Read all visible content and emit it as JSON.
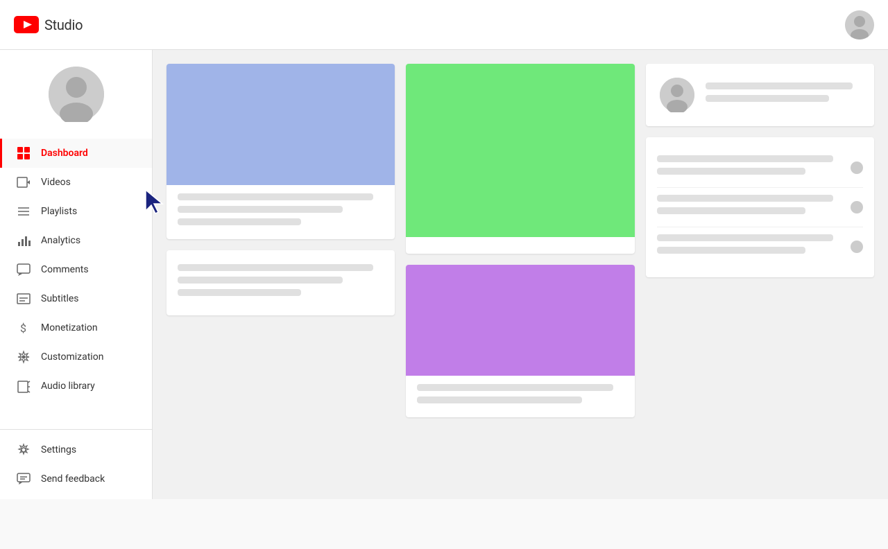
{
  "header": {
    "logo_text": "Studio",
    "youtube_icon": "yt-icon"
  },
  "sidebar": {
    "nav_items": [
      {
        "id": "dashboard",
        "label": "Dashboard",
        "icon": "dashboard-icon",
        "active": true
      },
      {
        "id": "videos",
        "label": "Videos",
        "icon": "videos-icon",
        "active": false
      },
      {
        "id": "playlists",
        "label": "Playlists",
        "icon": "playlists-icon",
        "active": false
      },
      {
        "id": "analytics",
        "label": "Analytics",
        "icon": "analytics-icon",
        "active": false
      },
      {
        "id": "comments",
        "label": "Comments",
        "icon": "comments-icon",
        "active": false
      },
      {
        "id": "subtitles",
        "label": "Subtitles",
        "icon": "subtitles-icon",
        "active": false
      },
      {
        "id": "monetization",
        "label": "Monetization",
        "icon": "monetization-icon",
        "active": false
      },
      {
        "id": "customization",
        "label": "Customization",
        "icon": "customization-icon",
        "active": false
      },
      {
        "id": "audio-library",
        "label": "Audio library",
        "icon": "audio-library-icon",
        "active": false
      }
    ],
    "bottom_items": [
      {
        "id": "settings",
        "label": "Settings",
        "icon": "settings-icon"
      },
      {
        "id": "send-feedback",
        "label": "Send feedback",
        "icon": "feedback-icon"
      }
    ]
  },
  "main": {
    "card1": {
      "thumbnail_color": "#a0b4e8"
    },
    "card2": {
      "thumbnail_color": "#6fe87a"
    },
    "card3": {
      "thumbnail_color": "#c17ee8"
    }
  },
  "colors": {
    "red": "#ff0000",
    "sidebar_bg": "#ffffff",
    "main_bg": "#f1f1f1",
    "card_bg": "#ffffff",
    "skeleton": "#e0e0e0",
    "avatar_bg": "#cccccc"
  }
}
